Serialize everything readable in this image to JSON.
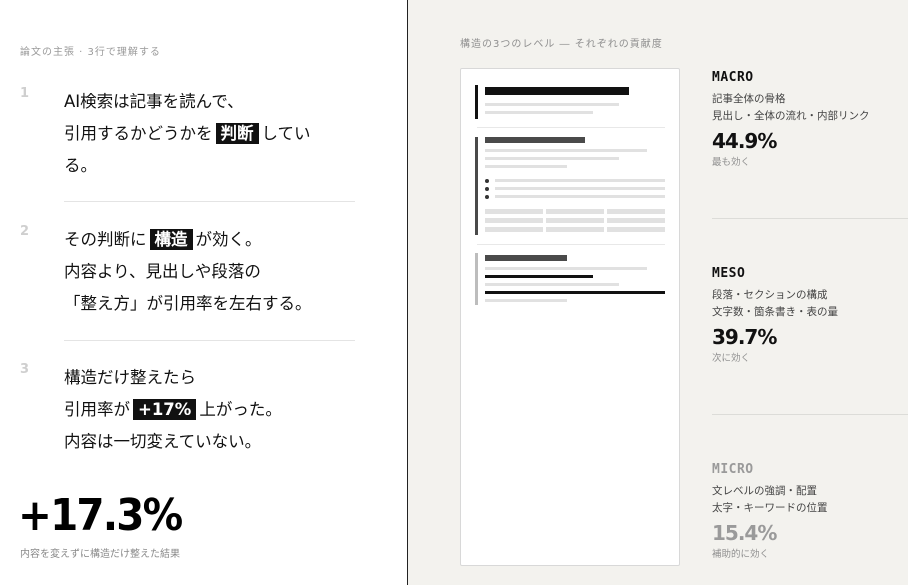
{
  "left": {
    "header": "論文の主張 · 3行で理解する",
    "points": [
      {
        "num": "1",
        "lines": [
          {
            "before": "AI検索は記事を読んで、",
            "hl": "",
            "after": ""
          },
          {
            "before": "引用するかどうかを",
            "hl": "判断",
            "after": "してい"
          },
          {
            "before": "る。",
            "hl": "",
            "after": ""
          }
        ]
      },
      {
        "num": "2",
        "lines": [
          {
            "before": "その判断に",
            "hl": "構造",
            "after": "が効く。"
          },
          {
            "before": "内容より、見出しや段落の",
            "hl": "",
            "after": ""
          },
          {
            "before": "「整え方」が引用率を左右する。",
            "hl": "",
            "after": ""
          }
        ]
      },
      {
        "num": "3",
        "lines": [
          {
            "before": "構造だけ整えたら",
            "hl": "",
            "after": ""
          },
          {
            "before": "引用率が",
            "hl": "+17%",
            "after": "上がった。"
          },
          {
            "before": "内容は一切変えていない。",
            "hl": "",
            "after": ""
          }
        ]
      }
    ],
    "big_stat": "+17.3%",
    "big_caption": "内容を変えずに構造だけ整えた結果"
  },
  "right": {
    "header": "構造の3つのレベル ― それぞれの貢献度",
    "levels": [
      {
        "name": "MACRO",
        "desc1": "記事全体の骨格",
        "desc2": "見出し・全体の流れ・内部リンク",
        "pct": "44.9%",
        "note": "最も効く"
      },
      {
        "name": "MESO",
        "desc1": "段落・セクションの構成",
        "desc2": "文字数・箇条書き・表の量",
        "pct": "39.7%",
        "note": "次に効く"
      },
      {
        "name": "MICRO",
        "desc1": "文レベルの強調・配置",
        "desc2": "太字・キーワードの位置",
        "pct": "15.4%",
        "note": "補助的に効く"
      }
    ]
  },
  "colors": {
    "ink": "#111111",
    "right_bg": "#f3f2ee",
    "muted": "#9a9a9a"
  }
}
